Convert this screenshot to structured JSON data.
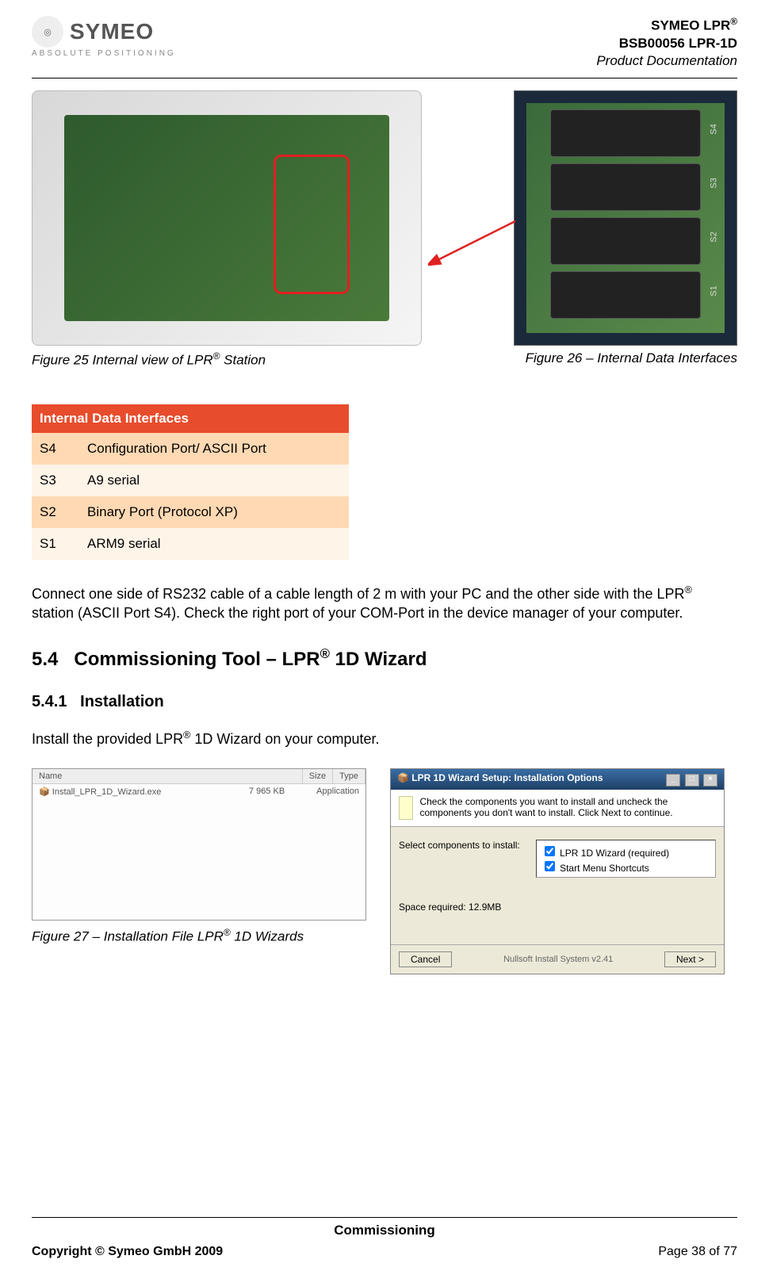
{
  "header": {
    "logo_name": "SYMEO",
    "logo_sub": "ABSOLUTE POSITIONING",
    "line1_pre": "SYMEO LPR",
    "line1_sup": "®",
    "line2": "BSB00056 LPR-1D",
    "line3": "Product Documentation"
  },
  "figures": {
    "fig25_pre": "Figure 25 Internal view of LPR",
    "fig25_sup": "®",
    "fig25_post": " Station",
    "fig26": "Figure 26 – Internal Data Interfaces",
    "fig27_pre": "Figure  27 – Installation File LPR",
    "fig27_sup": "®",
    "fig27_post": " 1D Wizards"
  },
  "ports_zoom": {
    "p1": "S4",
    "p2": "S3",
    "p3": "S2",
    "p4": "S1"
  },
  "interfaces": {
    "title": "Internal Data Interfaces",
    "rows": [
      {
        "k": "S4",
        "v": "Configuration Port/ ASCII Port"
      },
      {
        "k": "S3",
        "v": "A9 serial"
      },
      {
        "k": "S2",
        "v": "Binary Port (Protocol XP)"
      },
      {
        "k": "S1",
        "v": "ARM9 serial"
      }
    ]
  },
  "paragraph1_pre": "Connect one side of RS232 cable of a cable length of 2 m with your PC and the other side with the LPR",
  "paragraph1_sup": "®",
  "paragraph1_post": " station (ASCII Port S4). Check the right port of your COM-Port in the device manager of your computer.",
  "section54_num": "5.4",
  "section54_title_pre": "Commissioning Tool – LPR",
  "section54_title_sup": "®",
  "section54_title_post": " 1D Wizard",
  "section541_num": "5.4.1",
  "section541_title": "Installation",
  "install_text_pre": "Install the provided LPR",
  "install_text_sup": "®",
  "install_text_post": " 1D Wizard on your computer.",
  "explorer": {
    "col1": "Name",
    "col2": "Size",
    "col3": "Type",
    "file": "Install_LPR_1D_Wizard.exe",
    "size": "7 965 KB",
    "type": "Application"
  },
  "installer": {
    "title": "LPR 1D Wizard Setup: Installation Options",
    "desc": "Check the components you want to install and uncheck the components you don't want to install. Click Next to continue.",
    "select_label": "Select components to install:",
    "opt1": "LPR 1D Wizard (required)",
    "opt2": "Start Menu Shortcuts",
    "space": "Space required: 12.9MB",
    "cancel": "Cancel",
    "nsis": "Nullsoft Install System v2.41",
    "next": "Next >"
  },
  "footer": {
    "center": "Commissioning",
    "left": "Copyright © Symeo GmbH 2009",
    "right": "Page 38 of 77"
  }
}
